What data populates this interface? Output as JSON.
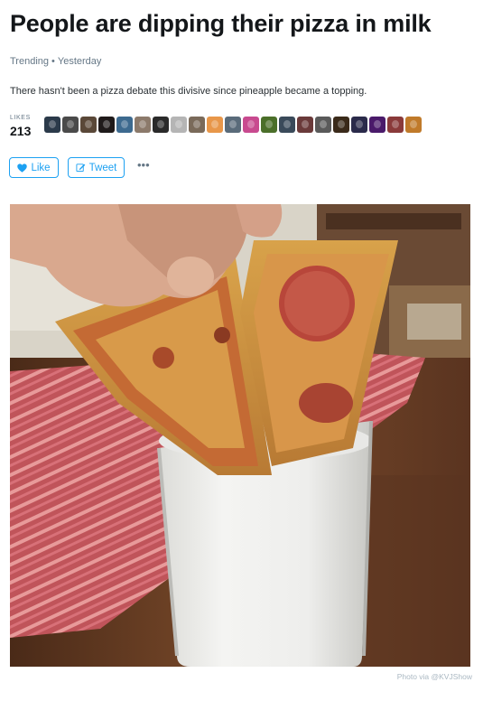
{
  "article": {
    "title": "People are dipping their pizza in milk",
    "category": "Trending",
    "separator": "•",
    "time": "Yesterday",
    "description": "There hasn't been a pizza debate this divisive since pineapple became a topping."
  },
  "likes": {
    "label": "LIKES",
    "count": "213",
    "avatar_colors": [
      "#2b3a4a",
      "#4a4a4a",
      "#5a4838",
      "#1f1a1a",
      "#3d6a8f",
      "#8c7a6b",
      "#2a2a2a",
      "#b5b5b5",
      "#7a6a5a",
      "#e8974a",
      "#5a6b7a",
      "#c84a8f",
      "#4b6f2a",
      "#3a4a5a",
      "#6a3a3a",
      "#5a5a5a",
      "#3a2a1a",
      "#2a2a4a",
      "#4a1a6a",
      "#8a3a3a",
      "#c07a2a"
    ]
  },
  "actions": {
    "like_label": "Like",
    "tweet_label": "Tweet",
    "more_label": "•••"
  },
  "photo": {
    "caption": "Photo via @KVJShow"
  },
  "colors": {
    "accent": "#1da1f2",
    "muted": "#657786",
    "caption": "#aab8c2"
  }
}
